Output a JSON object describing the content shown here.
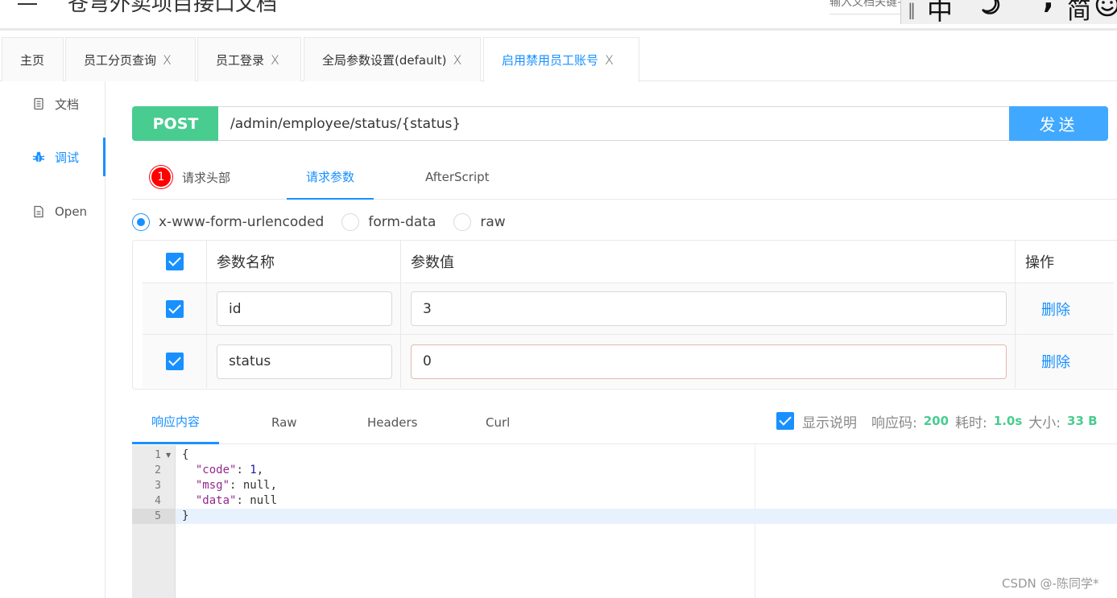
{
  "header": {
    "title": "苍穹外卖项目接口文档",
    "search_placeholder": "输入文档关键字"
  },
  "ime": {
    "separator": "‖",
    "mode": "中",
    "punct": "°,",
    "charset": "简"
  },
  "tabs": [
    {
      "label": "主页"
    },
    {
      "label": "员工分页查询",
      "close": "X"
    },
    {
      "label": "员工登录",
      "close": "X"
    },
    {
      "label": "全局参数设置(default)",
      "close": "X"
    },
    {
      "label": "启用禁用员工账号",
      "close": "X",
      "active": true
    }
  ],
  "sidenav": {
    "items": [
      {
        "label": "文档"
      },
      {
        "label": "调试",
        "active": true
      },
      {
        "label": "Open"
      }
    ]
  },
  "request": {
    "method": "POST",
    "url": "/admin/employee/status/{status}",
    "send_label": "发送",
    "tabs": [
      {
        "label": "请求头部",
        "badge": "1"
      },
      {
        "label": "请求参数",
        "active": true
      },
      {
        "label": "AfterScript"
      }
    ],
    "body_types": [
      {
        "label": "x-www-form-urlencoded",
        "checked": true
      },
      {
        "label": "form-data"
      },
      {
        "label": "raw"
      }
    ],
    "params": {
      "headers": {
        "name": "参数名称",
        "value": "参数值",
        "op": "操作"
      },
      "rows": [
        {
          "name": "id",
          "value": "3",
          "op": "删除"
        },
        {
          "name": "status",
          "value": "0",
          "op": "删除"
        }
      ]
    }
  },
  "response": {
    "tabs": [
      {
        "label": "响应内容",
        "active": true
      },
      {
        "label": "Raw"
      },
      {
        "label": "Headers"
      },
      {
        "label": "Curl"
      }
    ],
    "show_desc_label": "显示说明",
    "code_label": "响应码:",
    "code": "200",
    "time_label": "耗时:",
    "time": "1.0s",
    "size_label": "大小:",
    "size": "33 B",
    "body_lines": [
      "1",
      "2",
      "3",
      "4",
      "5"
    ]
  },
  "watermark": "CSDN @-陈同学*",
  "colors": {
    "accent": "#1890ff",
    "post": "#49cc90",
    "send": "#40a9ff",
    "badge": "#ff0000"
  }
}
